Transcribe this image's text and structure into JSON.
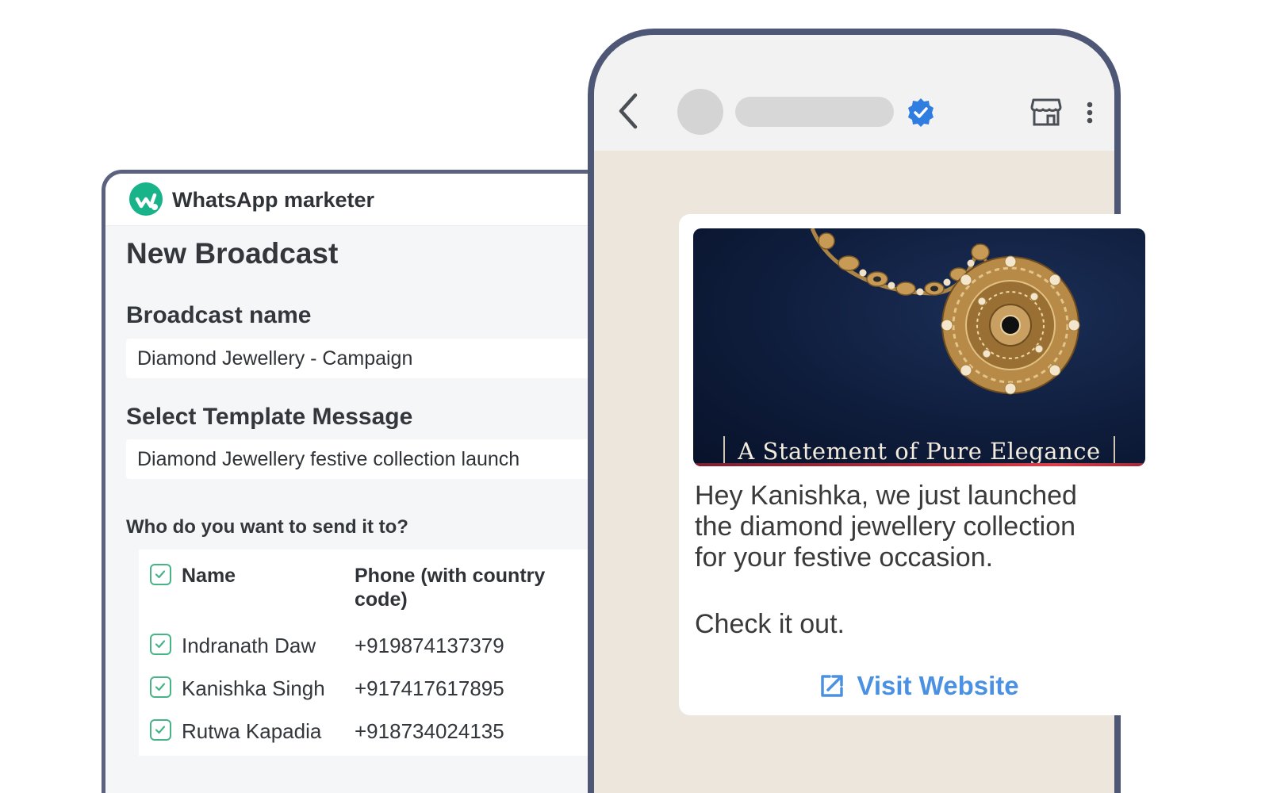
{
  "app": {
    "name": "WhatsApp marketer"
  },
  "broadcast": {
    "page_title": "New Broadcast",
    "name_label": "Broadcast name",
    "name_value": "Diamond Jewellery - Campaign",
    "template_label": "Select Template Message",
    "template_value": "Diamond Jewellery festive collection launch",
    "recipients_label": "Who do you want to send it to?",
    "table": {
      "headers": [
        "Name",
        "Phone (with country",
        "code)"
      ],
      "header_checked": true,
      "rows": [
        {
          "name": "Indranath Daw",
          "phone": "+919874137379",
          "checked": true
        },
        {
          "name": "Kanishka Singh",
          "phone": "+917417617895",
          "checked": true
        },
        {
          "name": "Rutwa Kapadia",
          "phone": "+918734024135",
          "checked": true
        }
      ]
    }
  },
  "preview": {
    "banner_caption": "A Statement of  Pure Elegance",
    "body_lines": [
      "Hey Kanishka, we just launched",
      "the diamond jewellery collection",
      "for your festive occasion."
    ],
    "cta_text": "Check it out.",
    "button_label": "Visit Website",
    "icons": {
      "back": "chevron-left-icon",
      "verified": "verified-badge-icon",
      "store": "storefront-icon",
      "menu": "more-vertical-icon",
      "link": "external-link-icon"
    }
  },
  "colors": {
    "brand_green": "#19b38a",
    "checkbox_green": "#46b487",
    "link_blue": "#4b91e3",
    "verified_blue": "#2f7de1",
    "frame": "#4f5777",
    "chat_bg": "#ece6dd"
  }
}
